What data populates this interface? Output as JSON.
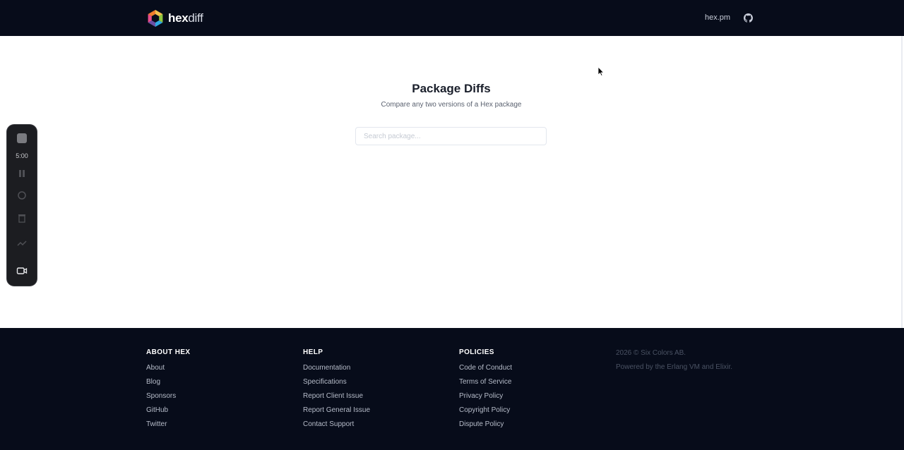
{
  "header": {
    "logo": {
      "bold": "hex",
      "rest": "diff"
    },
    "links": [
      {
        "label": "hex.pm"
      }
    ],
    "github_icon": "github-icon"
  },
  "main": {
    "title": "Package Diffs",
    "subtitle": "Compare any two versions of a Hex package",
    "search": {
      "placeholder": "Search package...",
      "value": ""
    }
  },
  "recorder": {
    "time": "5:00",
    "icons": [
      "stop-icon",
      "pause-icon",
      "restart-icon",
      "trash-icon",
      "draw-icon",
      "camera-icon"
    ]
  },
  "footer": {
    "columns": [
      {
        "heading": "ABOUT HEX",
        "links": [
          "About",
          "Blog",
          "Sponsors",
          "GitHub",
          "Twitter"
        ]
      },
      {
        "heading": "HELP",
        "links": [
          "Documentation",
          "Specifications",
          "Report Client Issue",
          "Report General Issue",
          "Contact Support"
        ]
      },
      {
        "heading": "POLICIES",
        "links": [
          "Code of Conduct",
          "Terms of Service",
          "Privacy Policy",
          "Copyright Policy",
          "Dispute Policy"
        ]
      }
    ],
    "copyright": "2026 © Six Colors AB.",
    "powered": "Powered by the Erlang VM and Elixir."
  },
  "colors": {
    "header_bg": "#070c1a",
    "footer_bg": "#070c1a",
    "title": "#1a1f2b"
  }
}
